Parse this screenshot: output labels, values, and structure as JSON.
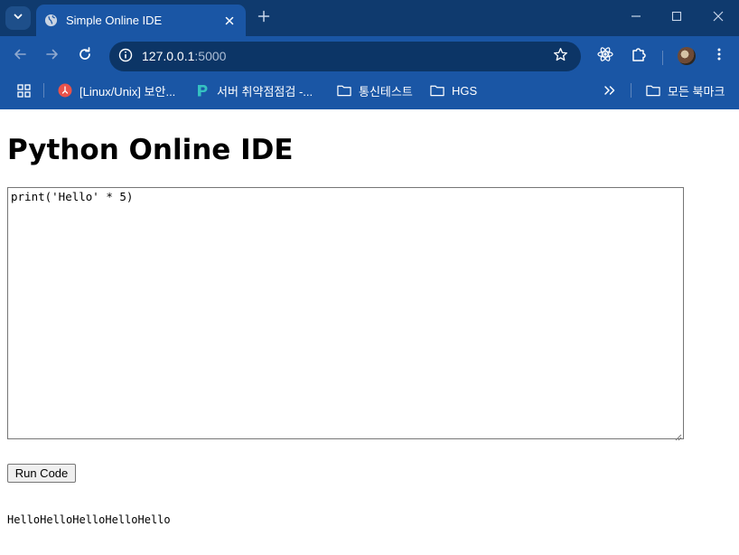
{
  "browser": {
    "tab": {
      "title": "Simple Online IDE"
    },
    "address": {
      "host": "127.0.0.1",
      "port": ":5000"
    },
    "colors": {
      "frame": "#0f3a6e",
      "toolbar": "#1a56a5",
      "omnibox": "#0c3566"
    }
  },
  "bookmarks": [
    {
      "label": "[Linux/Unix] 보안...",
      "icon": "red-site-favicon"
    },
    {
      "label": "서버 취약점점검 -...",
      "icon": "p-site-favicon"
    },
    {
      "label": "통신테스트",
      "icon": "folder-icon"
    },
    {
      "label": "HGS",
      "icon": "folder-icon"
    }
  ],
  "all_bookmarks_label": "모든 북마크",
  "page": {
    "title": "Python Online IDE",
    "code": "print('Hello' * 5)",
    "run_label": "Run Code",
    "output": "HelloHelloHelloHelloHello"
  }
}
